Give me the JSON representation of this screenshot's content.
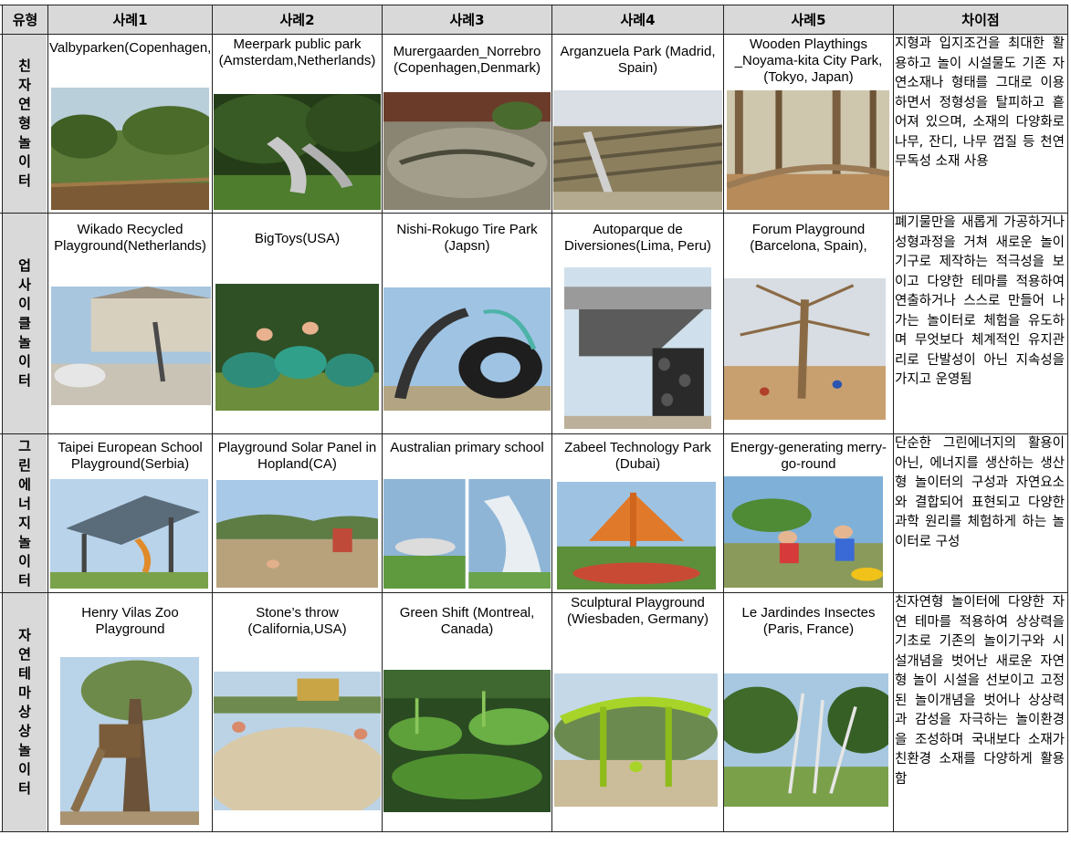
{
  "header": {
    "type_label": "유형",
    "case1": "사례1",
    "case2": "사례2",
    "case3": "사례3",
    "case4": "사례4",
    "case5": "사례5",
    "difference": "차이점"
  },
  "rows": [
    {
      "type": "친자연형놀이터",
      "cases": [
        {
          "caption": "Valbyparken(Copenhagen,Denmark)",
          "photo": "park with wooden play hills and trees"
        },
        {
          "caption": "Meerpark public park (Amsterdam,Netherlands)",
          "photo": "metal slides in green park"
        },
        {
          "caption": "Murergaarden_Norrebro (Copenhagen,Denmark)",
          "photo": "sunken playground with logs and stones"
        },
        {
          "caption": "Arganzuela Park (Madrid, Spain)",
          "photo": "wooden terrace with slides"
        },
        {
          "caption": "Wooden Playthings _Noyama-kita City Park, (Tokyo, Japan)",
          "photo": "curving wooden path in forest"
        }
      ],
      "difference": "지형과 입지조건을 최대한 활용하고 놀이 시설물도 기존 자연소재나 형태를 그대로 이용하면서 정형성을 탈피하고 흩어져 있으며, 소재의 다양화로 나무, 잔디, 나무 껍질 등 천연 무독성 소재 사용"
    },
    {
      "type": "업사이클놀이터",
      "cases": [
        {
          "caption": "Wikado Recycled Playground(Netherlands)",
          "photo": "recycled pipe playground near buildings"
        },
        {
          "caption": "BigToys(USA)",
          "photo": "children in green tube play structure"
        },
        {
          "caption": "Nishi-Rokugo Tire Park (Japsn)",
          "photo": "tire sculptures with children"
        },
        {
          "caption": "Autoparque de Diversiones(Lima, Peru)",
          "photo": "tire wall climbing structure"
        },
        {
          "caption": "Forum Playground (Barcelona, Spain),",
          "photo": "tree-like structure with ropes"
        }
      ],
      "difference": "폐기물만을 새롭게 가공하거나 성형과정을 거쳐 새로운 놀이기구로 제작하는 적극성을 보이고 다양한 테마를 적용하여 연출하거나 스스로 만들어 나가는 놀이터로 체험을 유도하며 무엇보다 체계적인 유지관리로 단발성이 아닌 지속성을 가지고 운영됨"
    },
    {
      "type": "그린에너지놀이터",
      "cases": [
        {
          "caption": "Taipei European School Playground(Serbia)",
          "photo": "solar canopy over playground"
        },
        {
          "caption": "Playground Solar Panel in Hopland(CA)",
          "photo": "playground with solar panel"
        },
        {
          "caption": "Australian primary school",
          "photo": "wind turbine play structures"
        },
        {
          "caption": "Zabeel Technology Park (Dubai)",
          "photo": "orange shade canopy park"
        },
        {
          "caption": "Energy-generating merry-go-round",
          "photo": "children on merry-go-round"
        }
      ],
      "difference": "단순한 그린에너지의 활용이 아닌, 에너지를 생산하는 생산형 놀이터의 구성과 자연요소와 결합되어 표현되고 다양한 과학 원리를 체험하게 하는 놀이터로 구성"
    },
    {
      "type": "자연테마상상놀이터",
      "cases": [
        {
          "caption": "Henry Vilas Zoo Playground",
          "photo": "tree house with slide"
        },
        {
          "caption": "Stone’s throw (California,USA)",
          "photo": "children on sand mound"
        },
        {
          "caption": "Green Shift (Montreal, Canada)",
          "photo": "green plant garden playground"
        },
        {
          "caption": "Sculptural Playground (Wiesbaden, Germany)",
          "photo": "green sculptural swing structure"
        },
        {
          "caption": "Le Jardindes Insectes (Paris, France)",
          "photo": "insect antenna poles in park"
        }
      ],
      "difference": "친자연형 놀이터에 다양한 자연 테마를 적용하여 상상력을 기초로 기존의 놀이기구와 시설개념을 벗어난 새로운 자연형 놀이 시설을 선보이고 고정된 놀이개념을 벗어나 상상력과 감성을 자극하는 놀이환경을 조성하며 국내보다 소재가 친환경 소재를 다양하게 활용함"
    }
  ],
  "colors": {
    "header_bg": "#d9d9d9",
    "border": "#222222"
  }
}
